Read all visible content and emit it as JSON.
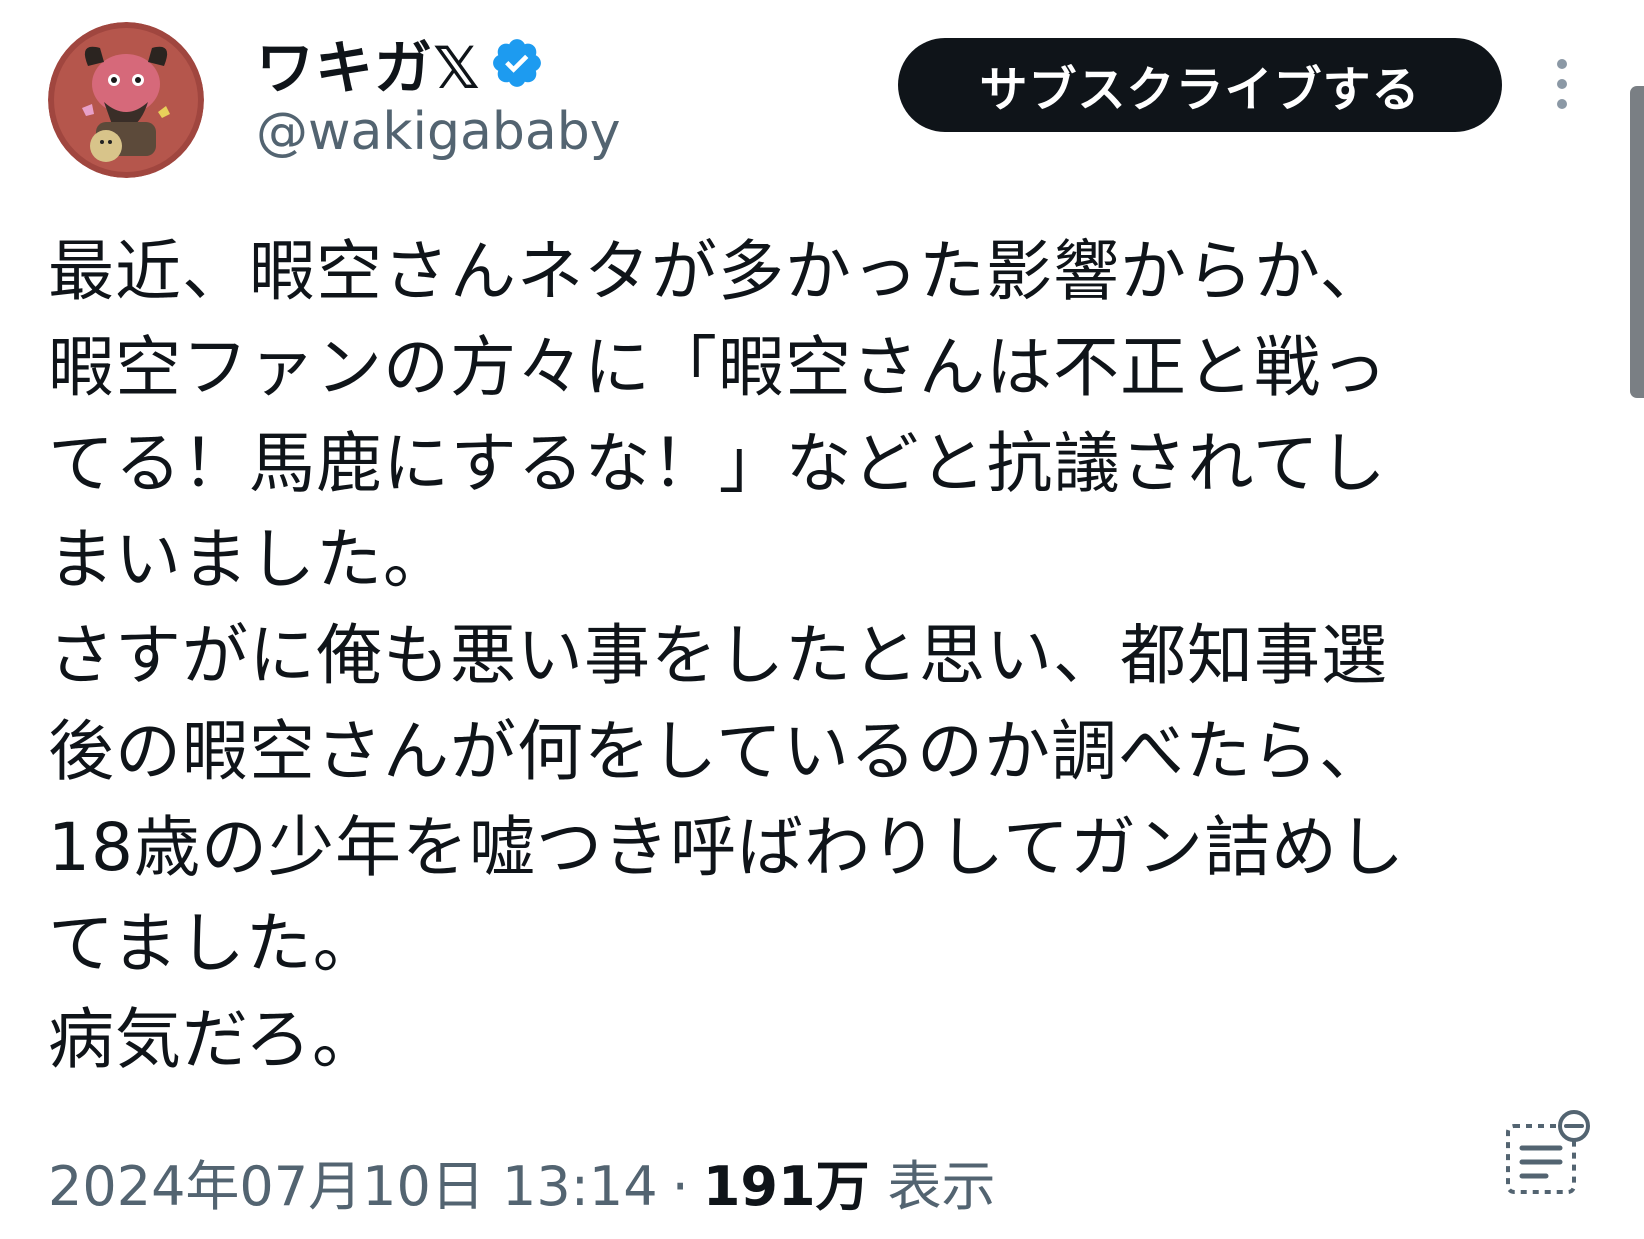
{
  "author": {
    "display_name": "ワキガ𝕏",
    "handle": "@wakigababy",
    "verified": true,
    "avatar": "avatar-illustration"
  },
  "actions": {
    "subscribe_label": "サブスクライブする",
    "more_icon": "more-vertical-icon"
  },
  "tweet": {
    "text": "最近、暇空さんネタが多かった影響からか、\n暇空ファンの方々に「暇空さんは不正と戦っ\nてる！馬鹿にするな！」などと抗議されてし\nまいました。\nさすがに俺も悪い事をしたと思い、都知事選\n後の暇空さんが何をしているのか調べたら、\n18歳の少年を嘘つき呼ばわりしてガン詰めし\nてました。\n病気だろ。"
  },
  "meta": {
    "timestamp": "2024年07月10日 13:14",
    "separator": "·",
    "views_count": "191万",
    "views_label": "表示"
  },
  "colors": {
    "text": "#0f1419",
    "secondary": "#536471",
    "verified": "#1d9bf0",
    "button_bg": "#0f1419"
  }
}
